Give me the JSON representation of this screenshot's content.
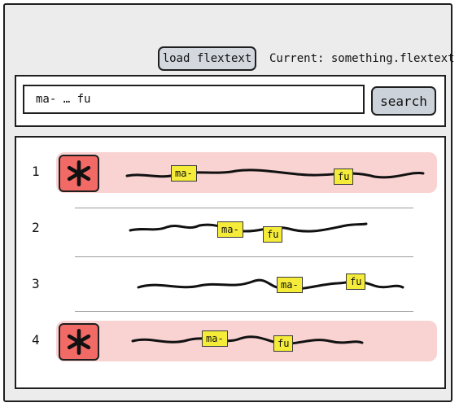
{
  "toolbar": {
    "load_label": "load flextext",
    "current_label": "Current: something.flextext"
  },
  "search": {
    "query": "ma- … fu",
    "button_label": "search"
  },
  "results": [
    {
      "number": "1",
      "flagged": true,
      "tags": [
        "ma-",
        "fu"
      ]
    },
    {
      "number": "2",
      "flagged": false,
      "tags": [
        "ma-",
        "fu"
      ]
    },
    {
      "number": "3",
      "flagged": false,
      "tags": [
        "ma-",
        "fu"
      ]
    },
    {
      "number": "4",
      "flagged": true,
      "tags": [
        "ma-",
        "fu"
      ]
    }
  ],
  "icons": {
    "flag_icon": "asterisk-icon",
    "text_line": "squiggle-line-icon"
  },
  "colors": {
    "highlight": "#f9d2d2",
    "flag": "#f26a66",
    "tag": "#f5ec3a",
    "button": "#d3d8df"
  }
}
